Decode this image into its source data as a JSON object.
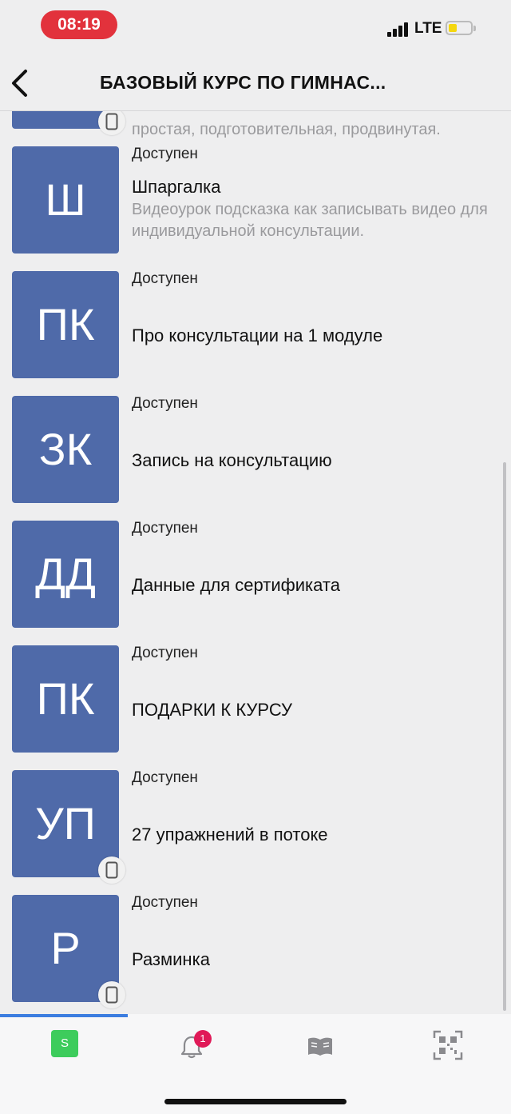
{
  "status_bar": {
    "time": "08:19",
    "network": "LTE"
  },
  "header": {
    "title": "БАЗОВЫЙ КУРС ПО ГИМНАС..."
  },
  "list": {
    "partial_desc": "простая, подготовительная, продвинутая.",
    "items": [
      {
        "initials": "Ш",
        "status": "Доступен",
        "title": "Шпаргалка",
        "desc": "Видеоурок подсказка как записывать видео для индивидуальной консультации."
      },
      {
        "initials": "ПК",
        "status": "Доступен",
        "title": "Про консультации на 1 модуле"
      },
      {
        "initials": "ЗК",
        "status": "Доступен",
        "title": "Запись на консультацию"
      },
      {
        "initials": "ДД",
        "status": "Доступен",
        "title": "Данные для сертификата"
      },
      {
        "initials": "ПК",
        "status": "Доступен",
        "title": "ПОДАРКИ К КУРСУ"
      },
      {
        "initials": "УП",
        "status": "Доступен",
        "title": "27 упражнений в потоке"
      },
      {
        "initials": "Р",
        "status": "Доступен",
        "title": "Разминка"
      }
    ]
  },
  "tab_bar": {
    "app_letter": "S",
    "notifications_count": "1"
  },
  "colors": {
    "tile": "#4f6aa9",
    "accent": "#3b7de0",
    "badge": "#e01a58",
    "app": "#3dcc5c",
    "time_pill": "#e2323c"
  },
  "icons": [
    "back-chevron-icon",
    "mobile-device-icon",
    "bell-icon",
    "book-icon",
    "qr-code-icon"
  ]
}
